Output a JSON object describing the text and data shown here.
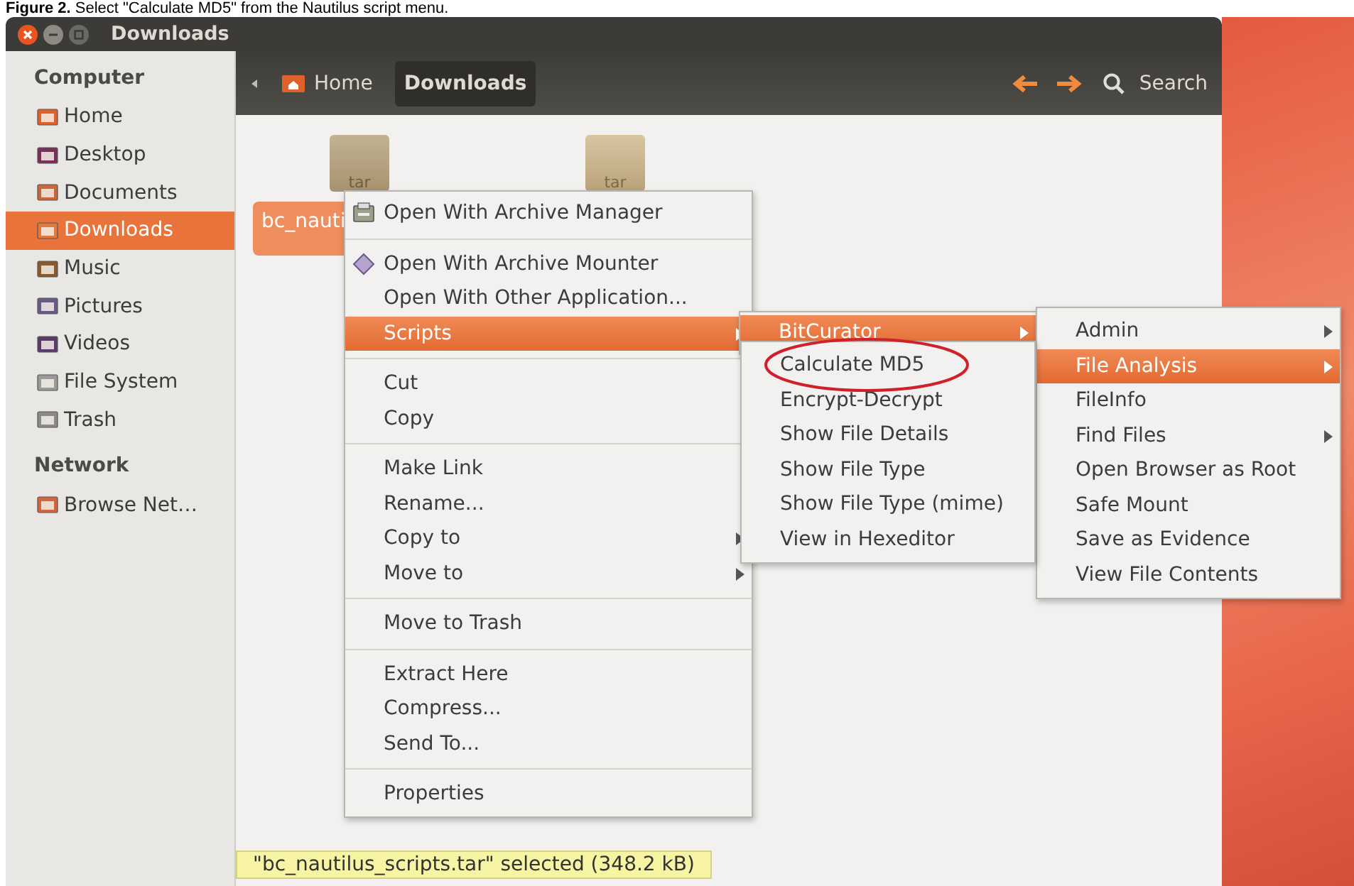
{
  "caption": "**Figure 2.** Select \"Calculate MD5\" from the Nautilus script menu.",
  "window": {
    "title": "Downloads"
  },
  "toolbar": {
    "breadcrumbs": [
      {
        "label": "Home",
        "selected": false
      },
      {
        "label": "Downloads",
        "selected": true
      }
    ],
    "search": "Search"
  },
  "sidebar": {
    "sections": [
      {
        "title": "Computer",
        "items": [
          {
            "label": "Home",
            "kind": "home",
            "selected": false
          },
          {
            "label": "Desktop",
            "kind": "desktop",
            "selected": false
          },
          {
            "label": "Documents",
            "kind": "documents",
            "selected": false
          },
          {
            "label": "Downloads",
            "kind": "downloads",
            "selected": true
          },
          {
            "label": "Music",
            "kind": "music",
            "selected": false
          },
          {
            "label": "Pictures",
            "kind": "pictures",
            "selected": false
          },
          {
            "label": "Videos",
            "kind": "videos",
            "selected": false
          },
          {
            "label": "File System",
            "kind": "drive",
            "selected": false
          },
          {
            "label": "Trash",
            "kind": "trash",
            "selected": false
          }
        ]
      },
      {
        "title": "Network",
        "items": [
          {
            "label": "Browse Net…",
            "kind": "network",
            "selected": false
          }
        ]
      }
    ]
  },
  "files": [
    {
      "badge": "tar",
      "label": "bc_nauti",
      "selected": true
    },
    {
      "badge": "tar",
      "selected": false
    }
  ],
  "context_menu": {
    "groups": [
      [
        {
          "label": "Open With Archive Manager",
          "kind": "archive-app",
          "submenu": false,
          "selected": false
        }
      ],
      [
        {
          "label": "Open With Archive Mounter",
          "kind": "mount-app",
          "submenu": false,
          "selected": false
        },
        {
          "label": "Open With Other Application...",
          "kind": "plain",
          "submenu": false,
          "selected": false
        },
        {
          "label": "Scripts",
          "kind": "plain",
          "submenu": true,
          "selected": true
        }
      ],
      [
        {
          "label": "Cut",
          "kind": "plain",
          "submenu": false,
          "selected": false
        },
        {
          "label": "Copy",
          "kind": "plain",
          "submenu": false,
          "selected": false
        }
      ],
      [
        {
          "label": "Make Link",
          "kind": "plain",
          "submenu": false,
          "selected": false
        },
        {
          "label": "Rename...",
          "kind": "plain",
          "submenu": false,
          "selected": false
        },
        {
          "label": "Copy to",
          "kind": "plain",
          "submenu": true,
          "selected": false
        },
        {
          "label": "Move to",
          "kind": "plain",
          "submenu": true,
          "selected": false
        }
      ],
      [
        {
          "label": "Move to Trash",
          "kind": "plain",
          "submenu": false,
          "selected": false
        }
      ],
      [
        {
          "label": "Extract Here",
          "kind": "plain",
          "submenu": false,
          "selected": false
        },
        {
          "label": "Compress...",
          "kind": "plain",
          "submenu": false,
          "selected": false
        },
        {
          "label": "Send To...",
          "kind": "plain",
          "submenu": false,
          "selected": false
        }
      ],
      [
        {
          "label": "Properties",
          "kind": "plain",
          "submenu": false,
          "selected": false
        }
      ]
    ]
  },
  "scripts_menu": {
    "items": [
      {
        "label": "BitCurator",
        "submenu": true,
        "selected": true
      }
    ]
  },
  "bitcurator_menu": {
    "items": [
      {
        "label": "Admin",
        "submenu": true,
        "selected": false
      },
      {
        "label": "File Analysis",
        "submenu": true,
        "selected": true
      },
      {
        "label": "FileInfo",
        "submenu": false,
        "selected": false
      },
      {
        "label": "Find Files",
        "submenu": true,
        "selected": false
      },
      {
        "label": "Open Browser as Root",
        "submenu": false,
        "selected": false
      },
      {
        "label": "Safe Mount",
        "submenu": false,
        "selected": false
      },
      {
        "label": "Save as Evidence",
        "submenu": false,
        "selected": false
      },
      {
        "label": "View File Contents",
        "submenu": false,
        "selected": false
      }
    ]
  },
  "file_analysis_menu": {
    "items": [
      {
        "label": "Calculate MD5",
        "circled": true
      },
      {
        "label": "Encrypt-Decrypt",
        "circled": false
      },
      {
        "label": "Show File Details",
        "circled": false
      },
      {
        "label": "Show File Type",
        "circled": false
      },
      {
        "label": "Show File Type (mime)",
        "circled": false
      },
      {
        "label": "View in Hexeditor",
        "circled": false
      }
    ]
  },
  "status_bar": "\"bc_nautilus_scripts.tar\" selected (348.2 kB)"
}
